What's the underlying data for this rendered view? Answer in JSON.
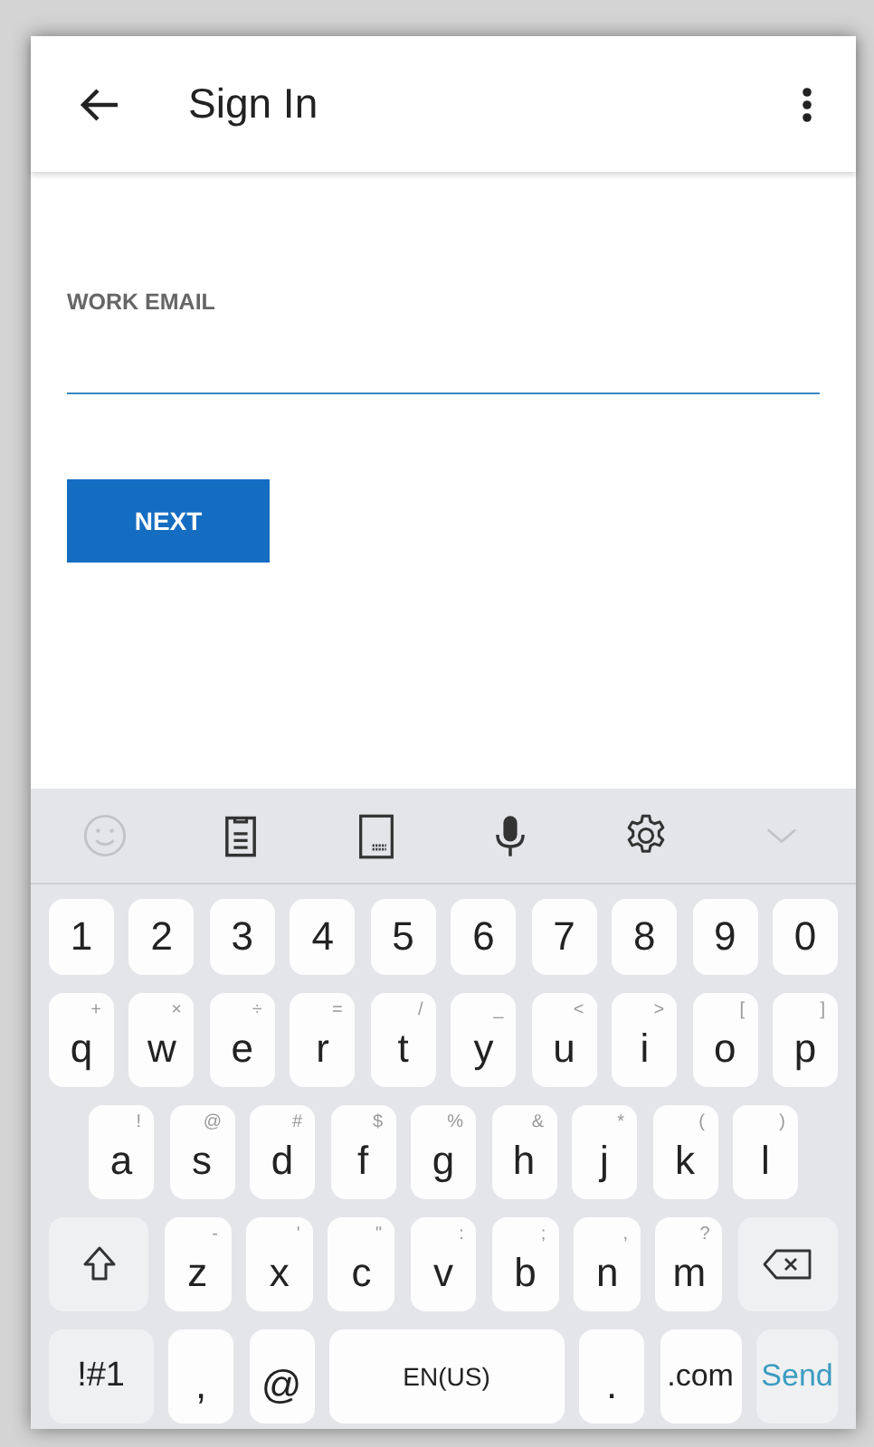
{
  "app_bar": {
    "title": "Sign In"
  },
  "form": {
    "label": "WORK EMAIL",
    "button": "NEXT"
  },
  "keyboard": {
    "toolbar": [
      {
        "kind": "emoji",
        "disabled": true
      },
      {
        "kind": "clipboard",
        "disabled": false
      },
      {
        "kind": "layout",
        "disabled": false
      },
      {
        "kind": "mic",
        "disabled": false
      },
      {
        "kind": "settings",
        "disabled": false
      },
      {
        "kind": "collapse",
        "disabled": true
      }
    ],
    "rows": [
      {
        "keys": [
          {
            "kind": "char",
            "label": "1"
          },
          {
            "kind": "char",
            "label": "2"
          },
          {
            "kind": "char",
            "label": "3"
          },
          {
            "kind": "char",
            "label": "4"
          },
          {
            "kind": "char",
            "label": "5"
          },
          {
            "kind": "char",
            "label": "6"
          },
          {
            "kind": "char",
            "label": "7"
          },
          {
            "kind": "char",
            "label": "8"
          },
          {
            "kind": "char",
            "label": "9"
          },
          {
            "kind": "char",
            "label": "0"
          }
        ]
      },
      {
        "keys": [
          {
            "kind": "char",
            "label": "q",
            "hint": "+"
          },
          {
            "kind": "char",
            "label": "w",
            "hint": "×"
          },
          {
            "kind": "char",
            "label": "e",
            "hint": "÷"
          },
          {
            "kind": "char",
            "label": "r",
            "hint": "="
          },
          {
            "kind": "char",
            "label": "t",
            "hint": "/"
          },
          {
            "kind": "char",
            "label": "y",
            "hint": "_"
          },
          {
            "kind": "char",
            "label": "u",
            "hint": "<"
          },
          {
            "kind": "char",
            "label": "i",
            "hint": ">"
          },
          {
            "kind": "char",
            "label": "o",
            "hint": "["
          },
          {
            "kind": "char",
            "label": "p",
            "hint": "]"
          }
        ]
      },
      {
        "keys": [
          {
            "kind": "char",
            "label": "a",
            "hint": "!"
          },
          {
            "kind": "char",
            "label": "s",
            "hint": "@"
          },
          {
            "kind": "char",
            "label": "d",
            "hint": "#"
          },
          {
            "kind": "char",
            "label": "f",
            "hint": "$"
          },
          {
            "kind": "char",
            "label": "g",
            "hint": "%"
          },
          {
            "kind": "char",
            "label": "h",
            "hint": "&"
          },
          {
            "kind": "char",
            "label": "j",
            "hint": "*"
          },
          {
            "kind": "char",
            "label": "k",
            "hint": "("
          },
          {
            "kind": "char",
            "label": "l",
            "hint": ")"
          }
        ]
      },
      {
        "keys": [
          {
            "kind": "shift"
          },
          {
            "kind": "char",
            "label": "z",
            "hint": "-"
          },
          {
            "kind": "char",
            "label": "x",
            "hint": "'"
          },
          {
            "kind": "char",
            "label": "c",
            "hint": "\""
          },
          {
            "kind": "char",
            "label": "v",
            "hint": ":"
          },
          {
            "kind": "char",
            "label": "b",
            "hint": ";"
          },
          {
            "kind": "char",
            "label": "n",
            "hint": ","
          },
          {
            "kind": "char",
            "label": "m",
            "hint": "?"
          },
          {
            "kind": "backspace"
          }
        ]
      },
      {
        "keys": [
          {
            "kind": "mode",
            "label": "!#1"
          },
          {
            "kind": "char",
            "label": ","
          },
          {
            "kind": "char",
            "label": "@"
          },
          {
            "kind": "space",
            "label": "EN(US)"
          },
          {
            "kind": "char",
            "label": "."
          },
          {
            "kind": "domain",
            "label": ".com"
          },
          {
            "kind": "send",
            "label": "Send"
          }
        ]
      }
    ]
  }
}
